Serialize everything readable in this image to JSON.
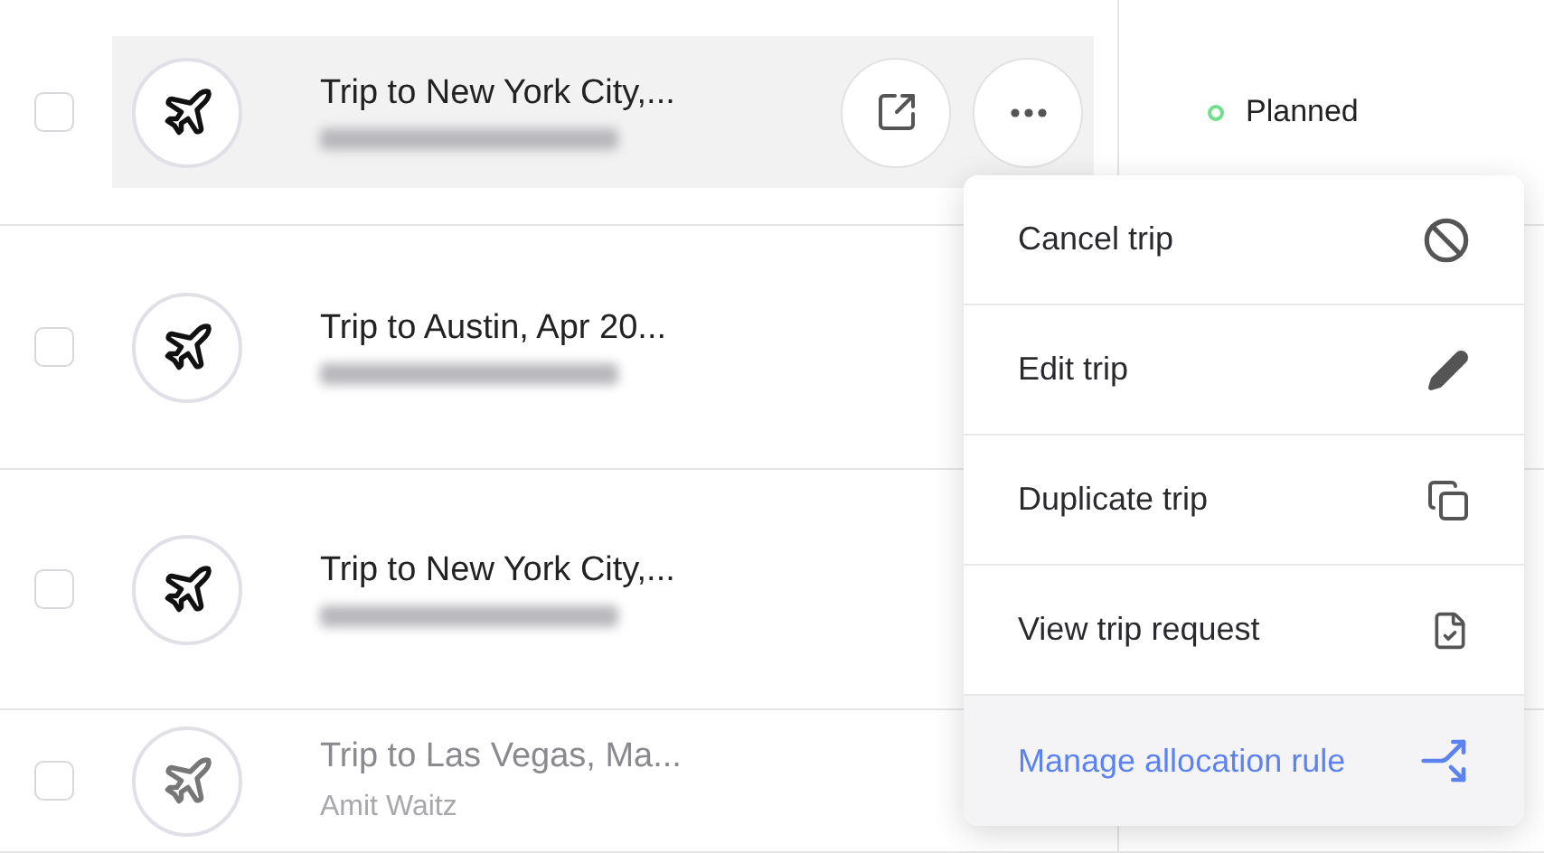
{
  "trips": [
    {
      "title": "Trip to New York City,...",
      "name_blurred": true,
      "selected": true,
      "checked": false,
      "muted": false,
      "status": {
        "label": "Planned",
        "kind": "planned"
      }
    },
    {
      "title": "Trip to Austin, Apr 20...",
      "name_blurred": true,
      "selected": false,
      "checked": false,
      "muted": false
    },
    {
      "title": "Trip to New York City,...",
      "name_blurred": true,
      "selected": false,
      "checked": false,
      "muted": false
    },
    {
      "title": "Trip to Las Vegas, Ma...",
      "name": "Amit Waitz",
      "selected": false,
      "checked": false,
      "muted": true
    }
  ],
  "menu": {
    "items": [
      {
        "label": "Cancel trip",
        "kind": "action",
        "selected": false
      },
      {
        "label": "Edit trip",
        "kind": "action",
        "selected": false
      },
      {
        "label": "Duplicate trip",
        "kind": "action",
        "selected": false
      },
      {
        "label": "View trip request",
        "kind": "action",
        "selected": false
      },
      {
        "label": "Manage allocation rule",
        "kind": "link",
        "selected": true
      }
    ]
  }
}
